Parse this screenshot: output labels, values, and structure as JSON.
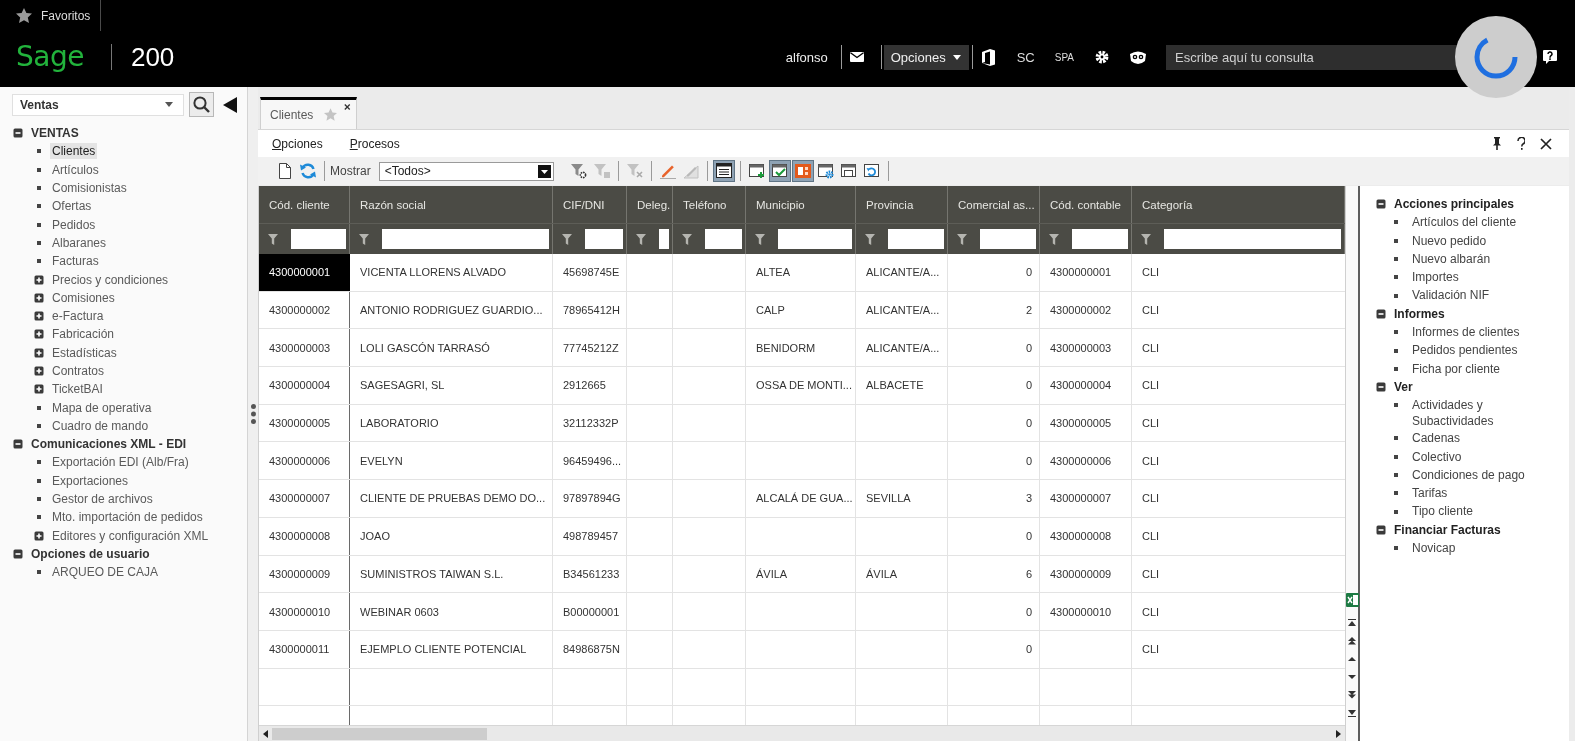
{
  "top_bar": {
    "favorites": "Favoritos",
    "brand": "Sage",
    "product": "200",
    "user": "alfonso",
    "options_button": "Opciones",
    "company": "SC",
    "language": "SPA",
    "search": {
      "placeholder": "Escribe aquí tu consulta"
    }
  },
  "sidebar": {
    "module": "Ventas",
    "tree": [
      {
        "label": "VENTAS",
        "kind": "folder",
        "expanded": true,
        "selected": false,
        "children": [
          {
            "label": "Clientes",
            "kind": "leaf",
            "selected": true
          },
          {
            "label": "Artículos",
            "kind": "leaf",
            "selected": false
          },
          {
            "label": "Comisionistas",
            "kind": "leaf",
            "selected": false
          },
          {
            "label": "Ofertas",
            "kind": "leaf",
            "selected": false
          },
          {
            "label": "Pedidos",
            "kind": "leaf",
            "selected": false
          },
          {
            "label": "Albaranes",
            "kind": "leaf",
            "selected": false
          },
          {
            "label": "Facturas",
            "kind": "leaf",
            "selected": false
          },
          {
            "label": "Precios y condiciones",
            "kind": "folder",
            "expanded": false,
            "selected": false
          },
          {
            "label": "Comisiones",
            "kind": "folder",
            "expanded": false,
            "selected": false
          },
          {
            "label": "e-Factura",
            "kind": "folder",
            "expanded": false,
            "selected": false
          },
          {
            "label": "Fabricación",
            "kind": "folder",
            "expanded": false,
            "selected": false
          },
          {
            "label": "Estadísticas",
            "kind": "folder",
            "expanded": false,
            "selected": false
          },
          {
            "label": "Contratos",
            "kind": "folder",
            "expanded": false,
            "selected": false
          },
          {
            "label": "TicketBAI",
            "kind": "folder",
            "expanded": false,
            "selected": false
          },
          {
            "label": "Mapa de operativa",
            "kind": "leaf",
            "selected": false
          },
          {
            "label": "Cuadro de mando",
            "kind": "leaf",
            "selected": false
          }
        ]
      },
      {
        "label": "Comunicaciones XML - EDI",
        "kind": "folder",
        "expanded": true,
        "selected": false,
        "children": [
          {
            "label": "Exportación EDI (Alb/Fra)",
            "kind": "leaf",
            "selected": false
          },
          {
            "label": "Exportaciones",
            "kind": "leaf",
            "selected": false
          },
          {
            "label": "Gestor de archivos",
            "kind": "leaf",
            "selected": false
          },
          {
            "label": "Mto. importación de pedidos",
            "kind": "leaf",
            "selected": false
          },
          {
            "label": "Editores y configuración XML",
            "kind": "folder",
            "expanded": false,
            "selected": false
          }
        ]
      },
      {
        "label": "Opciones de usuario",
        "kind": "folder",
        "expanded": true,
        "selected": false,
        "children": [
          {
            "label": "ARQUEO DE CAJA",
            "kind": "leaf",
            "selected": false
          }
        ]
      }
    ]
  },
  "document_tabs": [
    {
      "label": "Clientes",
      "selected": true
    }
  ],
  "menu": [
    "Opciones",
    "Procesos"
  ],
  "toolbar": {
    "show_label": "Mostrar",
    "show_value": "<Todos>",
    "buttons": [
      {
        "pressed": false,
        "disabled": false
      },
      {
        "pressed": false,
        "disabled": false
      },
      {
        "pressed": false,
        "disabled": false
      },
      {
        "pressed": false,
        "disabled": true
      },
      {
        "pressed": false,
        "disabled": true
      },
      {
        "pressed": false,
        "disabled": false
      },
      {
        "pressed": false,
        "disabled": true
      },
      {
        "pressed": true,
        "disabled": false
      },
      {
        "pressed": false,
        "disabled": false
      },
      {
        "pressed": true,
        "disabled": false
      },
      {
        "pressed": true,
        "disabled": false
      },
      {
        "pressed": false,
        "disabled": false
      },
      {
        "pressed": false,
        "disabled": false
      },
      {
        "pressed": false,
        "disabled": false
      }
    ]
  },
  "table": {
    "columns": [
      {
        "label": "Cód. cliente",
        "kind": "text"
      },
      {
        "label": "Razón social",
        "kind": "text"
      },
      {
        "label": "CIF/DNI",
        "kind": "text"
      },
      {
        "label": "Deleg.",
        "kind": "text"
      },
      {
        "label": "Teléfono",
        "kind": "text"
      },
      {
        "label": "Municipio",
        "kind": "text"
      },
      {
        "label": "Provincia",
        "kind": "text"
      },
      {
        "label": "Comercial as...",
        "kind": "number"
      },
      {
        "label": "Cód. contable",
        "kind": "text"
      },
      {
        "label": "Categoría",
        "kind": "text"
      }
    ],
    "rows": [
      {
        "selected": true,
        "code": "4300000001",
        "name": "VICENTA LLORENS ALVADO",
        "tax_id": "45698745E",
        "town": "ALTEA",
        "province": "ALICANTE/A...",
        "sales_rep": "0",
        "account": "4300000001",
        "category": "CLI"
      },
      {
        "selected": false,
        "code": "4300000002",
        "name": "ANTONIO RODRIGUEZ GUARDIO...",
        "tax_id": "78965412H",
        "town": "CALP",
        "province": "ALICANTE/A...",
        "sales_rep": "2",
        "account": "4300000002",
        "category": "CLI"
      },
      {
        "selected": false,
        "code": "4300000003",
        "name": "LOLI GASCÓN TARRASÓ",
        "tax_id": "77745212Z",
        "town": "BENIDORM",
        "province": "ALICANTE/A...",
        "sales_rep": "0",
        "account": "4300000003",
        "category": "CLI"
      },
      {
        "selected": false,
        "code": "4300000004",
        "name": "SAGESAGRI, SL",
        "tax_id": "2912665",
        "town": "OSSA DE MONTI...",
        "province": "ALBACETE",
        "sales_rep": "0",
        "account": "4300000004",
        "category": "CLI"
      },
      {
        "selected": false,
        "code": "4300000005",
        "name": "LABORATORIO",
        "tax_id": "32112332P",
        "sales_rep": "0",
        "account": "4300000005",
        "category": "CLI"
      },
      {
        "selected": false,
        "code": "4300000006",
        "name": "EVELYN",
        "tax_id": "96459496...",
        "sales_rep": "0",
        "account": "4300000006",
        "category": "CLI"
      },
      {
        "selected": false,
        "code": "4300000007",
        "name": "CLIENTE DE PRUEBAS DEMO DO...",
        "tax_id": "97897894G",
        "town": "ALCALÁ DE GUA...",
        "province": "SEVILLA",
        "sales_rep": "3",
        "account": "4300000007",
        "category": "CLI"
      },
      {
        "selected": false,
        "code": "4300000008",
        "name": "JOAO",
        "tax_id": "498789457",
        "sales_rep": "0",
        "account": "4300000008",
        "category": "CLI"
      },
      {
        "selected": false,
        "code": "4300000009",
        "name": "SUMINISTROS TAIWAN S.L.",
        "tax_id": "B34561233",
        "town": "ÁVILA",
        "province": "ÁVILA",
        "sales_rep": "6",
        "account": "4300000009",
        "category": "CLI"
      },
      {
        "selected": false,
        "code": "4300000010",
        "name": "WEBINAR 0603",
        "tax_id": "B00000001",
        "sales_rep": "0",
        "account": "4300000010",
        "category": "CLI"
      },
      {
        "selected": false,
        "code": "4300000011",
        "name": "EJEMPLO CLIENTE POTENCIAL",
        "tax_id": "84986875N",
        "sales_rep": "0",
        "category": "CLI"
      }
    ]
  },
  "actions_panel": {
    "sections": [
      {
        "title": "Acciones principales",
        "expanded": true,
        "items": [
          "Artículos del cliente",
          "Nuevo pedido",
          "Nuevo albarán",
          "Importes",
          "Validación NIF"
        ]
      },
      {
        "title": "Informes",
        "expanded": true,
        "items": [
          "Informes de clientes",
          "Pedidos pendientes",
          "Ficha por cliente"
        ]
      },
      {
        "title": "Ver",
        "expanded": true,
        "items": [
          "Actividades y Subactividades",
          "Cadenas",
          "Colectivo",
          "Condiciones de pago",
          "Tarifas",
          "Tipo cliente"
        ]
      },
      {
        "title": "Financiar Facturas",
        "expanded": true,
        "items": [
          "Novicap"
        ]
      }
    ]
  }
}
